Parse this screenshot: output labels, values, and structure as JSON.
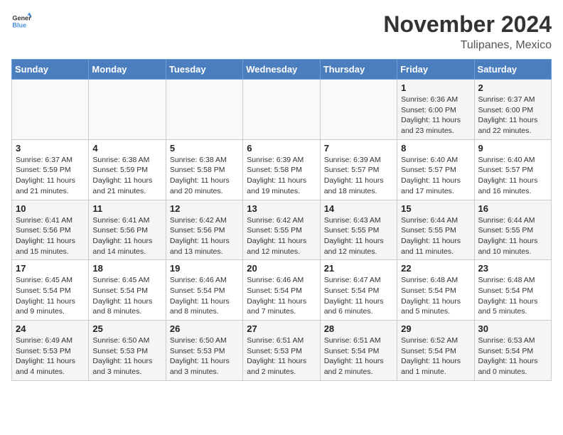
{
  "header": {
    "logo_general": "General",
    "logo_blue": "Blue",
    "month_title": "November 2024",
    "location": "Tulipanes, Mexico"
  },
  "days_of_week": [
    "Sunday",
    "Monday",
    "Tuesday",
    "Wednesday",
    "Thursday",
    "Friday",
    "Saturday"
  ],
  "weeks": [
    [
      {
        "day": "",
        "detail": ""
      },
      {
        "day": "",
        "detail": ""
      },
      {
        "day": "",
        "detail": ""
      },
      {
        "day": "",
        "detail": ""
      },
      {
        "day": "",
        "detail": ""
      },
      {
        "day": "1",
        "detail": "Sunrise: 6:36 AM\nSunset: 6:00 PM\nDaylight: 11 hours and 23 minutes."
      },
      {
        "day": "2",
        "detail": "Sunrise: 6:37 AM\nSunset: 6:00 PM\nDaylight: 11 hours and 22 minutes."
      }
    ],
    [
      {
        "day": "3",
        "detail": "Sunrise: 6:37 AM\nSunset: 5:59 PM\nDaylight: 11 hours and 21 minutes."
      },
      {
        "day": "4",
        "detail": "Sunrise: 6:38 AM\nSunset: 5:59 PM\nDaylight: 11 hours and 21 minutes."
      },
      {
        "day": "5",
        "detail": "Sunrise: 6:38 AM\nSunset: 5:58 PM\nDaylight: 11 hours and 20 minutes."
      },
      {
        "day": "6",
        "detail": "Sunrise: 6:39 AM\nSunset: 5:58 PM\nDaylight: 11 hours and 19 minutes."
      },
      {
        "day": "7",
        "detail": "Sunrise: 6:39 AM\nSunset: 5:57 PM\nDaylight: 11 hours and 18 minutes."
      },
      {
        "day": "8",
        "detail": "Sunrise: 6:40 AM\nSunset: 5:57 PM\nDaylight: 11 hours and 17 minutes."
      },
      {
        "day": "9",
        "detail": "Sunrise: 6:40 AM\nSunset: 5:57 PM\nDaylight: 11 hours and 16 minutes."
      }
    ],
    [
      {
        "day": "10",
        "detail": "Sunrise: 6:41 AM\nSunset: 5:56 PM\nDaylight: 11 hours and 15 minutes."
      },
      {
        "day": "11",
        "detail": "Sunrise: 6:41 AM\nSunset: 5:56 PM\nDaylight: 11 hours and 14 minutes."
      },
      {
        "day": "12",
        "detail": "Sunrise: 6:42 AM\nSunset: 5:56 PM\nDaylight: 11 hours and 13 minutes."
      },
      {
        "day": "13",
        "detail": "Sunrise: 6:42 AM\nSunset: 5:55 PM\nDaylight: 11 hours and 12 minutes."
      },
      {
        "day": "14",
        "detail": "Sunrise: 6:43 AM\nSunset: 5:55 PM\nDaylight: 11 hours and 12 minutes."
      },
      {
        "day": "15",
        "detail": "Sunrise: 6:44 AM\nSunset: 5:55 PM\nDaylight: 11 hours and 11 minutes."
      },
      {
        "day": "16",
        "detail": "Sunrise: 6:44 AM\nSunset: 5:55 PM\nDaylight: 11 hours and 10 minutes."
      }
    ],
    [
      {
        "day": "17",
        "detail": "Sunrise: 6:45 AM\nSunset: 5:54 PM\nDaylight: 11 hours and 9 minutes."
      },
      {
        "day": "18",
        "detail": "Sunrise: 6:45 AM\nSunset: 5:54 PM\nDaylight: 11 hours and 8 minutes."
      },
      {
        "day": "19",
        "detail": "Sunrise: 6:46 AM\nSunset: 5:54 PM\nDaylight: 11 hours and 8 minutes."
      },
      {
        "day": "20",
        "detail": "Sunrise: 6:46 AM\nSunset: 5:54 PM\nDaylight: 11 hours and 7 minutes."
      },
      {
        "day": "21",
        "detail": "Sunrise: 6:47 AM\nSunset: 5:54 PM\nDaylight: 11 hours and 6 minutes."
      },
      {
        "day": "22",
        "detail": "Sunrise: 6:48 AM\nSunset: 5:54 PM\nDaylight: 11 hours and 5 minutes."
      },
      {
        "day": "23",
        "detail": "Sunrise: 6:48 AM\nSunset: 5:54 PM\nDaylight: 11 hours and 5 minutes."
      }
    ],
    [
      {
        "day": "24",
        "detail": "Sunrise: 6:49 AM\nSunset: 5:53 PM\nDaylight: 11 hours and 4 minutes."
      },
      {
        "day": "25",
        "detail": "Sunrise: 6:50 AM\nSunset: 5:53 PM\nDaylight: 11 hours and 3 minutes."
      },
      {
        "day": "26",
        "detail": "Sunrise: 6:50 AM\nSunset: 5:53 PM\nDaylight: 11 hours and 3 minutes."
      },
      {
        "day": "27",
        "detail": "Sunrise: 6:51 AM\nSunset: 5:53 PM\nDaylight: 11 hours and 2 minutes."
      },
      {
        "day": "28",
        "detail": "Sunrise: 6:51 AM\nSunset: 5:54 PM\nDaylight: 11 hours and 2 minutes."
      },
      {
        "day": "29",
        "detail": "Sunrise: 6:52 AM\nSunset: 5:54 PM\nDaylight: 11 hours and 1 minute."
      },
      {
        "day": "30",
        "detail": "Sunrise: 6:53 AM\nSunset: 5:54 PM\nDaylight: 11 hours and 0 minutes."
      }
    ]
  ]
}
